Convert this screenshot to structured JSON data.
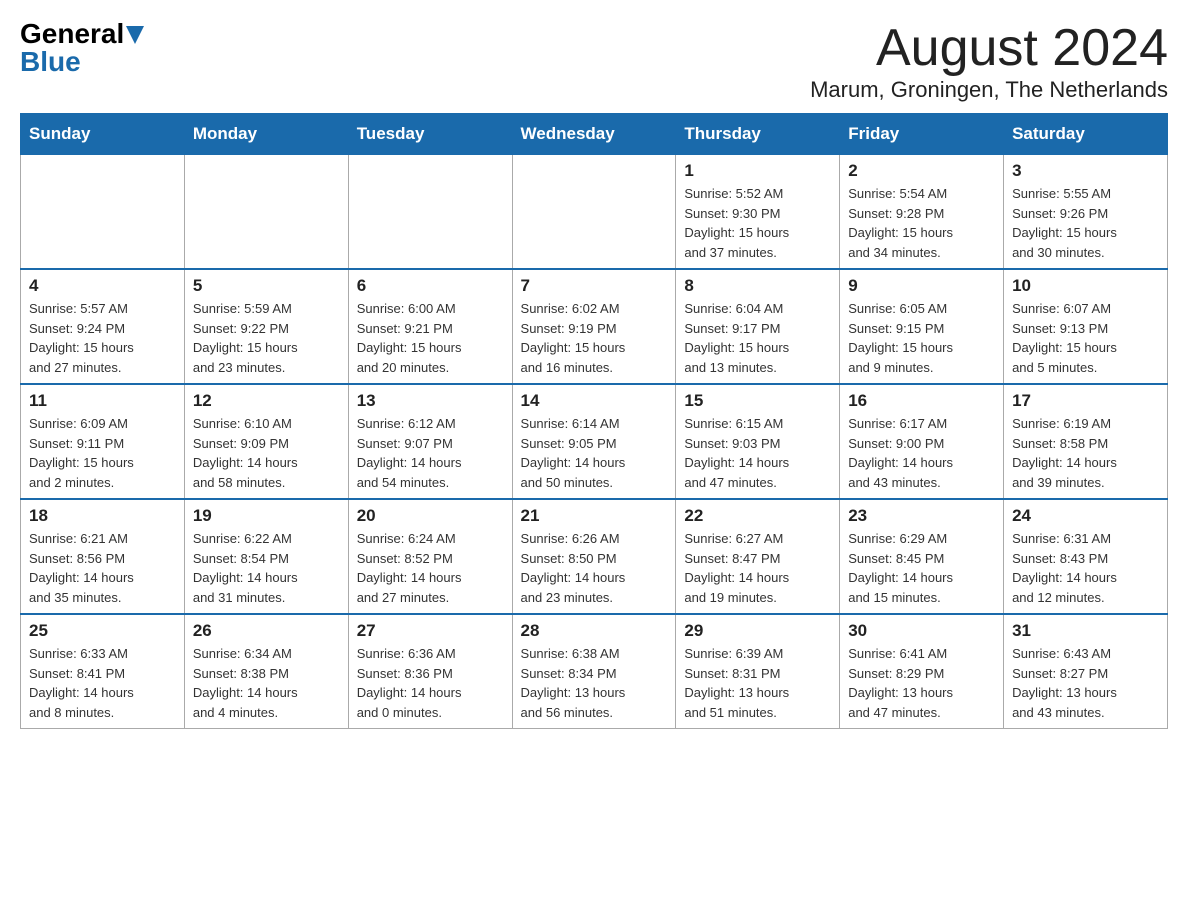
{
  "header": {
    "logo_general": "General",
    "logo_blue": "Blue",
    "month_title": "August 2024",
    "location": "Marum, Groningen, The Netherlands"
  },
  "days_of_week": [
    "Sunday",
    "Monday",
    "Tuesday",
    "Wednesday",
    "Thursday",
    "Friday",
    "Saturday"
  ],
  "weeks": [
    [
      {
        "day": "",
        "info": ""
      },
      {
        "day": "",
        "info": ""
      },
      {
        "day": "",
        "info": ""
      },
      {
        "day": "",
        "info": ""
      },
      {
        "day": "1",
        "info": "Sunrise: 5:52 AM\nSunset: 9:30 PM\nDaylight: 15 hours\nand 37 minutes."
      },
      {
        "day": "2",
        "info": "Sunrise: 5:54 AM\nSunset: 9:28 PM\nDaylight: 15 hours\nand 34 minutes."
      },
      {
        "day": "3",
        "info": "Sunrise: 5:55 AM\nSunset: 9:26 PM\nDaylight: 15 hours\nand 30 minutes."
      }
    ],
    [
      {
        "day": "4",
        "info": "Sunrise: 5:57 AM\nSunset: 9:24 PM\nDaylight: 15 hours\nand 27 minutes."
      },
      {
        "day": "5",
        "info": "Sunrise: 5:59 AM\nSunset: 9:22 PM\nDaylight: 15 hours\nand 23 minutes."
      },
      {
        "day": "6",
        "info": "Sunrise: 6:00 AM\nSunset: 9:21 PM\nDaylight: 15 hours\nand 20 minutes."
      },
      {
        "day": "7",
        "info": "Sunrise: 6:02 AM\nSunset: 9:19 PM\nDaylight: 15 hours\nand 16 minutes."
      },
      {
        "day": "8",
        "info": "Sunrise: 6:04 AM\nSunset: 9:17 PM\nDaylight: 15 hours\nand 13 minutes."
      },
      {
        "day": "9",
        "info": "Sunrise: 6:05 AM\nSunset: 9:15 PM\nDaylight: 15 hours\nand 9 minutes."
      },
      {
        "day": "10",
        "info": "Sunrise: 6:07 AM\nSunset: 9:13 PM\nDaylight: 15 hours\nand 5 minutes."
      }
    ],
    [
      {
        "day": "11",
        "info": "Sunrise: 6:09 AM\nSunset: 9:11 PM\nDaylight: 15 hours\nand 2 minutes."
      },
      {
        "day": "12",
        "info": "Sunrise: 6:10 AM\nSunset: 9:09 PM\nDaylight: 14 hours\nand 58 minutes."
      },
      {
        "day": "13",
        "info": "Sunrise: 6:12 AM\nSunset: 9:07 PM\nDaylight: 14 hours\nand 54 minutes."
      },
      {
        "day": "14",
        "info": "Sunrise: 6:14 AM\nSunset: 9:05 PM\nDaylight: 14 hours\nand 50 minutes."
      },
      {
        "day": "15",
        "info": "Sunrise: 6:15 AM\nSunset: 9:03 PM\nDaylight: 14 hours\nand 47 minutes."
      },
      {
        "day": "16",
        "info": "Sunrise: 6:17 AM\nSunset: 9:00 PM\nDaylight: 14 hours\nand 43 minutes."
      },
      {
        "day": "17",
        "info": "Sunrise: 6:19 AM\nSunset: 8:58 PM\nDaylight: 14 hours\nand 39 minutes."
      }
    ],
    [
      {
        "day": "18",
        "info": "Sunrise: 6:21 AM\nSunset: 8:56 PM\nDaylight: 14 hours\nand 35 minutes."
      },
      {
        "day": "19",
        "info": "Sunrise: 6:22 AM\nSunset: 8:54 PM\nDaylight: 14 hours\nand 31 minutes."
      },
      {
        "day": "20",
        "info": "Sunrise: 6:24 AM\nSunset: 8:52 PM\nDaylight: 14 hours\nand 27 minutes."
      },
      {
        "day": "21",
        "info": "Sunrise: 6:26 AM\nSunset: 8:50 PM\nDaylight: 14 hours\nand 23 minutes."
      },
      {
        "day": "22",
        "info": "Sunrise: 6:27 AM\nSunset: 8:47 PM\nDaylight: 14 hours\nand 19 minutes."
      },
      {
        "day": "23",
        "info": "Sunrise: 6:29 AM\nSunset: 8:45 PM\nDaylight: 14 hours\nand 15 minutes."
      },
      {
        "day": "24",
        "info": "Sunrise: 6:31 AM\nSunset: 8:43 PM\nDaylight: 14 hours\nand 12 minutes."
      }
    ],
    [
      {
        "day": "25",
        "info": "Sunrise: 6:33 AM\nSunset: 8:41 PM\nDaylight: 14 hours\nand 8 minutes."
      },
      {
        "day": "26",
        "info": "Sunrise: 6:34 AM\nSunset: 8:38 PM\nDaylight: 14 hours\nand 4 minutes."
      },
      {
        "day": "27",
        "info": "Sunrise: 6:36 AM\nSunset: 8:36 PM\nDaylight: 14 hours\nand 0 minutes."
      },
      {
        "day": "28",
        "info": "Sunrise: 6:38 AM\nSunset: 8:34 PM\nDaylight: 13 hours\nand 56 minutes."
      },
      {
        "day": "29",
        "info": "Sunrise: 6:39 AM\nSunset: 8:31 PM\nDaylight: 13 hours\nand 51 minutes."
      },
      {
        "day": "30",
        "info": "Sunrise: 6:41 AM\nSunset: 8:29 PM\nDaylight: 13 hours\nand 47 minutes."
      },
      {
        "day": "31",
        "info": "Sunrise: 6:43 AM\nSunset: 8:27 PM\nDaylight: 13 hours\nand 43 minutes."
      }
    ]
  ]
}
